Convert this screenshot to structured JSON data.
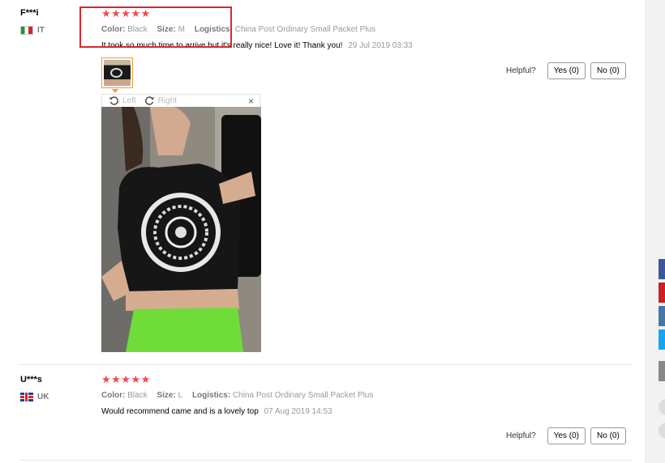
{
  "reviews": [
    {
      "user": "F***i",
      "country_code": "IT",
      "rating": "★★★★★",
      "color_label": "Color:",
      "color_value": "Black",
      "size_label": "Size:",
      "size_value": "M",
      "logistics_label": "Logistics:",
      "logistics_value": "China Post Ordinary Small Packet Plus",
      "text": "It took so much time to arrive but it's really nice! Love it! Thank you!",
      "date": "29 Jul 2019 03:33",
      "helpful_label": "Helpful?",
      "yes_label": "Yes (0)",
      "no_label": "No (0)"
    },
    {
      "user": "U***s",
      "country_code": "UK",
      "rating": "★★★★★",
      "color_label": "Color:",
      "color_value": "Black",
      "size_label": "Size:",
      "size_value": "L",
      "logistics_label": "Logistics:",
      "logistics_value": "China Post Ordinary Small Packet Plus",
      "text": "Would recommend came and is a lovely top",
      "date": "07 Aug 2019 14:53",
      "helpful_label": "Helpful?",
      "yes_label": "Yes (0)",
      "no_label": "No (0)"
    }
  ],
  "viewer": {
    "rotate_left": "Left",
    "rotate_right": "Right",
    "close": "×"
  },
  "colors": {
    "star": "#f2494b",
    "highlight": "#d8282f",
    "thumb_border": "#f29b38"
  },
  "share_icons": [
    "facebook-icon",
    "pinterest-icon",
    "vk-icon",
    "twitter-icon",
    "more-icon"
  ]
}
